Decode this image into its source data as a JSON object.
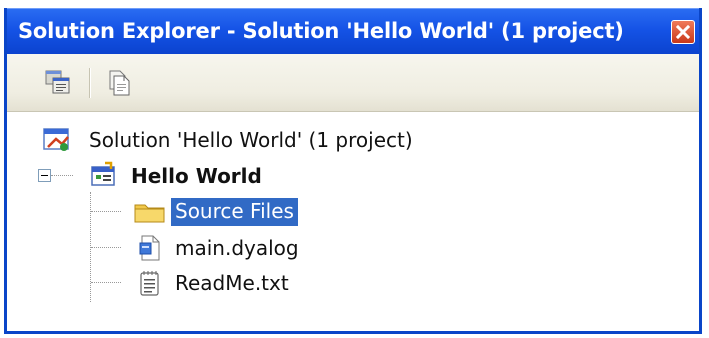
{
  "window": {
    "title": "Solution Explorer - Solution 'Hello World' (1 project)"
  },
  "toolbar": {
    "buttons": [
      {
        "icon": "properties-icon"
      },
      {
        "icon": "show-all-files-icon"
      }
    ]
  },
  "tree": {
    "solution": {
      "label": "Solution 'Hello World' (1 project)",
      "icon": "solution-icon"
    },
    "project": {
      "label": "Hello World",
      "icon": "project-icon",
      "expanded": true
    },
    "children": [
      {
        "label": "Source Files",
        "icon": "folder-icon",
        "selected": true
      },
      {
        "label": "main.dyalog",
        "icon": "dyalog-file-icon",
        "selected": false
      },
      {
        "label": "ReadMe.txt",
        "icon": "text-file-icon",
        "selected": false
      }
    ]
  },
  "colors": {
    "titlebar": "#0b43cf",
    "selection": "#316ac5",
    "toolbar": "#efede1",
    "close": "#c9381a"
  }
}
